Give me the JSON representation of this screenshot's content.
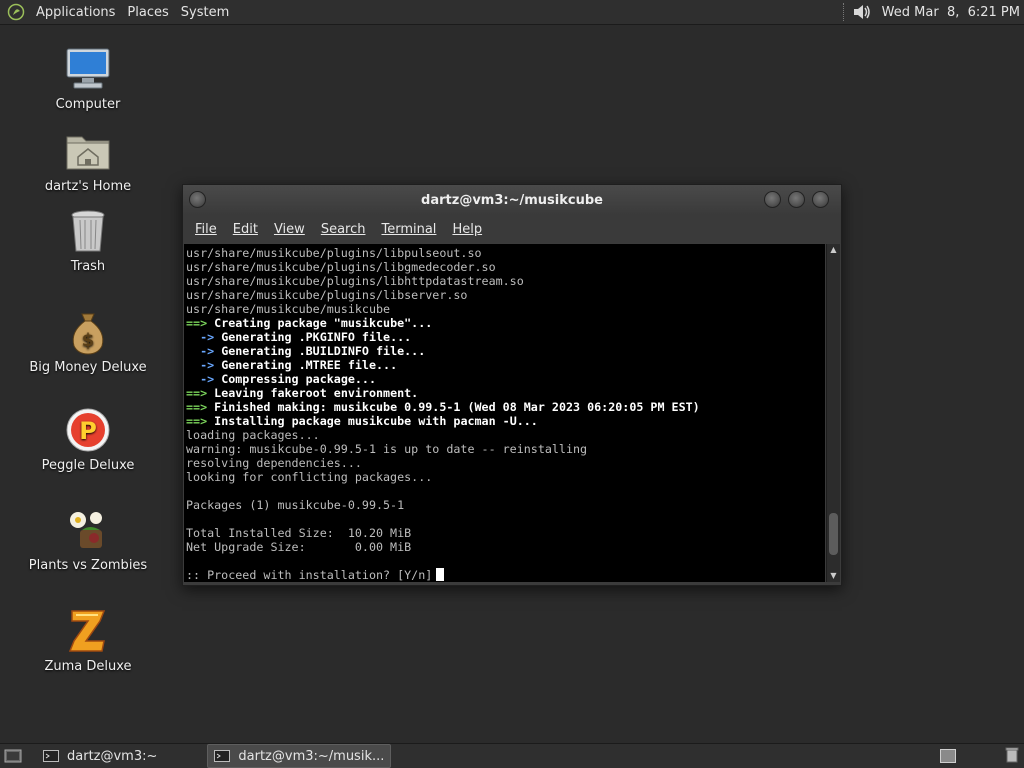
{
  "top_panel": {
    "menus": [
      "Applications",
      "Places",
      "System"
    ],
    "clock": "Wed Mar  8,  6:21 PM"
  },
  "desktop_icons": [
    {
      "label": "Computer",
      "icon": "computer-icon"
    },
    {
      "label": "dartz's Home",
      "icon": "home-folder-icon"
    },
    {
      "label": "Trash",
      "icon": "trash-icon"
    },
    {
      "label": "Big Money Deluxe",
      "icon": "money-bag-icon"
    },
    {
      "label": "Peggle Deluxe",
      "icon": "peggle-icon"
    },
    {
      "label": "Plants vs Zombies",
      "icon": "plants-vs-zombies-icon"
    },
    {
      "label": "Zuma Deluxe",
      "icon": "zuma-icon"
    }
  ],
  "window": {
    "title": "dartz@vm3:~/musikcube",
    "menu": [
      "File",
      "Edit",
      "View",
      "Search",
      "Terminal",
      "Help"
    ],
    "terminal_lines": [
      {
        "segments": [
          {
            "text": "usr/share/musikcube/plugins/libpulseout.so",
            "color": "gray"
          }
        ]
      },
      {
        "segments": [
          {
            "text": "usr/share/musikcube/plugins/libgmedecoder.so",
            "color": "gray"
          }
        ]
      },
      {
        "segments": [
          {
            "text": "usr/share/musikcube/plugins/libhttpdatastream.so",
            "color": "gray"
          }
        ]
      },
      {
        "segments": [
          {
            "text": "usr/share/musikcube/plugins/libserver.so",
            "color": "gray"
          }
        ]
      },
      {
        "segments": [
          {
            "text": "usr/share/musikcube/musikcube",
            "color": "gray"
          }
        ]
      },
      {
        "segments": [
          {
            "text": "==>",
            "color": "green"
          },
          {
            "text": " Creating package \"musikcube\"...",
            "color": "white"
          }
        ]
      },
      {
        "segments": [
          {
            "text": "  ->",
            "color": "blue"
          },
          {
            "text": " Generating .PKGINFO file...",
            "color": "white"
          }
        ]
      },
      {
        "segments": [
          {
            "text": "  ->",
            "color": "blue"
          },
          {
            "text": " Generating .BUILDINFO file...",
            "color": "white"
          }
        ]
      },
      {
        "segments": [
          {
            "text": "  ->",
            "color": "blue"
          },
          {
            "text": " Generating .MTREE file...",
            "color": "white"
          }
        ]
      },
      {
        "segments": [
          {
            "text": "  ->",
            "color": "blue"
          },
          {
            "text": " Compressing package...",
            "color": "white"
          }
        ]
      },
      {
        "segments": [
          {
            "text": "==>",
            "color": "green"
          },
          {
            "text": " Leaving fakeroot environment.",
            "color": "white"
          }
        ]
      },
      {
        "segments": [
          {
            "text": "==>",
            "color": "green"
          },
          {
            "text": " Finished making: musikcube 0.99.5-1 (Wed 08 Mar 2023 06:20:05 PM EST)",
            "color": "white"
          }
        ]
      },
      {
        "segments": [
          {
            "text": "==>",
            "color": "green"
          },
          {
            "text": " Installing package musikcube with pacman -U...",
            "color": "white"
          }
        ]
      },
      {
        "segments": [
          {
            "text": "loading packages...",
            "color": "gray"
          }
        ]
      },
      {
        "segments": [
          {
            "text": "warning: musikcube-0.99.5-1 is up to date -- reinstalling",
            "color": "gray"
          }
        ]
      },
      {
        "segments": [
          {
            "text": "resolving dependencies...",
            "color": "gray"
          }
        ]
      },
      {
        "segments": [
          {
            "text": "looking for conflicting packages...",
            "color": "gray"
          }
        ]
      },
      {
        "segments": [
          {
            "text": "",
            "color": "gray"
          }
        ]
      },
      {
        "segments": [
          {
            "text": "Packages (1) musikcube-0.99.5-1",
            "color": "gray"
          }
        ]
      },
      {
        "segments": [
          {
            "text": "",
            "color": "gray"
          }
        ]
      },
      {
        "segments": [
          {
            "text": "Total Installed Size:  10.20 MiB",
            "color": "gray"
          }
        ]
      },
      {
        "segments": [
          {
            "text": "Net Upgrade Size:       0.00 MiB",
            "color": "gray"
          }
        ]
      },
      {
        "segments": [
          {
            "text": "",
            "color": "gray"
          }
        ]
      },
      {
        "segments": [
          {
            "text": ":: Proceed with installation? [Y/n]",
            "color": "gray"
          }
        ],
        "cursor": true
      }
    ],
    "scroll_position": 0.95
  },
  "taskbar": {
    "tasks": [
      {
        "label": "dartz@vm3:~",
        "active": false
      },
      {
        "label": "dartz@vm3:~/musik...",
        "active": true
      }
    ]
  },
  "colors": {
    "desktop_bg": "#2b2b2b",
    "panel_bg": "#2f2f2f",
    "terminal_bg": "#000000",
    "prompt_green": "#7bd35b",
    "arrow_blue": "#6aa8ff"
  }
}
